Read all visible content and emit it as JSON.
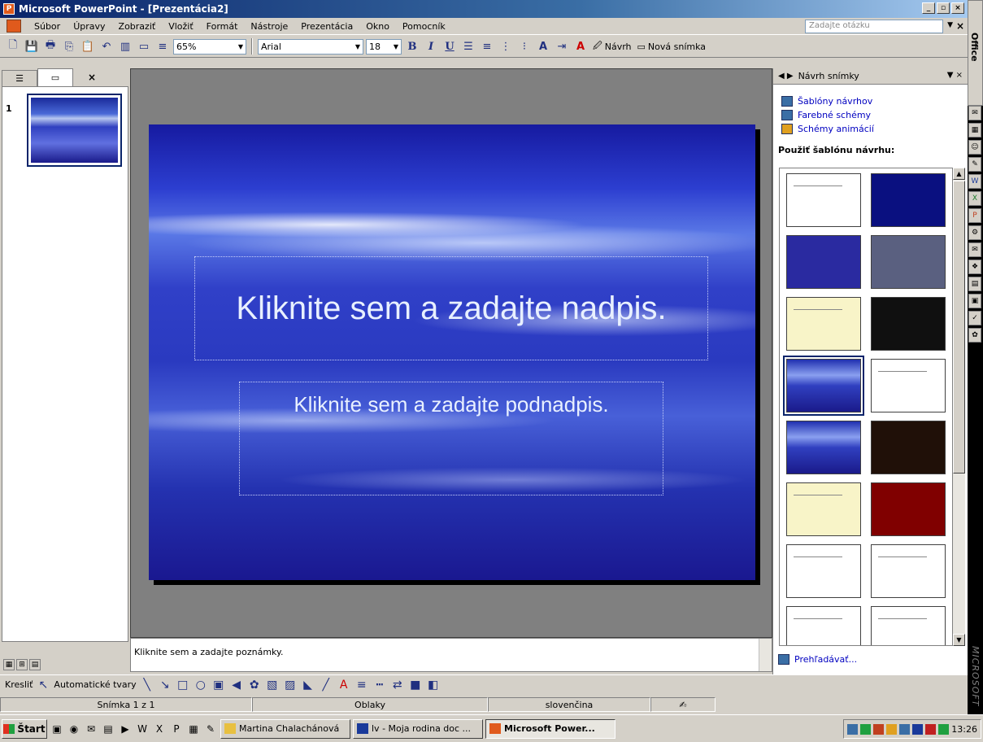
{
  "window": {
    "title": "Microsoft PowerPoint - [Prezentácia2]",
    "controls": [
      "_",
      "▫",
      "×"
    ]
  },
  "menu": {
    "items": [
      "Súbor",
      "Úpravy",
      "Zobraziť",
      "Vložiť",
      "Formát",
      "Nástroje",
      "Prezentácia",
      "Okno",
      "Pomocník"
    ],
    "help_placeholder": "Zadajte otázku"
  },
  "toolbar": {
    "zoom": "65%",
    "font": "Arial",
    "size": "18",
    "bold": "B",
    "italic": "I",
    "underline": "U",
    "design_label": "Návrh",
    "new_slide_label": "Nová snímka"
  },
  "outline": {
    "slide_number": "1"
  },
  "slide": {
    "title_placeholder": "Kliknite sem a zadajte nadpis.",
    "subtitle_placeholder": "Kliknite sem a zadajte podnadpis."
  },
  "notes": {
    "placeholder": "Kliknite sem a zadajte poznámky."
  },
  "taskpane": {
    "title": "Návrh snímky",
    "links": [
      "Šablóny návrhov",
      "Farebné schémy",
      "Schémy animácií"
    ],
    "section": "Použiť šablónu návrhu:",
    "designs": [
      "white",
      "navy",
      "blue",
      "gray",
      "yellow",
      "black",
      "cloud",
      "white",
      "cloud",
      "darkbrown",
      "yellow",
      "red",
      "white",
      "white",
      "white",
      "white"
    ],
    "footer": "Prehľadávať..."
  },
  "drawbar": {
    "draw_label": "Kresliť",
    "autoshapes_label": "Automatické tvary"
  },
  "status": {
    "slide": "Snímka 1 z 1",
    "template": "Oblaky",
    "language": "slovenčina"
  },
  "taskbar": {
    "start": "Štart",
    "tasks": [
      "Martina Chalachánová",
      "lv - Moja rodina doc ...",
      "Microsoft Power..."
    ],
    "clock": "13:26"
  },
  "office_bar": {
    "label": "Office",
    "brand": "MICROSOFT"
  }
}
